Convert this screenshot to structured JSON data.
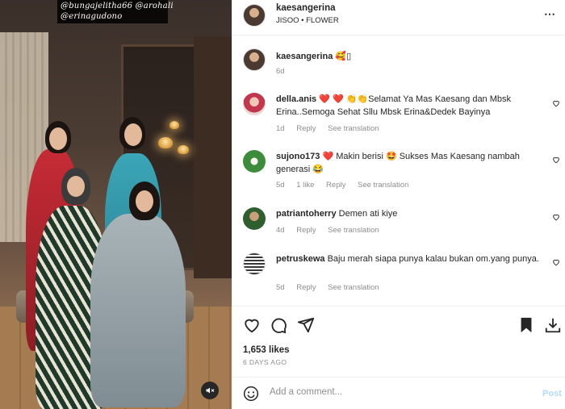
{
  "photo": {
    "tags": [
      "@bungajelitha66 @arohali",
      "@erinagudono"
    ],
    "mute_icon": "speaker-muted-icon"
  },
  "header": {
    "username": "kaesangerina",
    "audio": "JISOO • FLOWER",
    "more_icon": "ellipsis-icon"
  },
  "caption": {
    "username": "kaesangerina",
    "text": "🥰▯",
    "age": "6d"
  },
  "comments": [
    {
      "username": "della.anis",
      "text": "❤️ ❤️ 👏👏Selamat Ya Mas Kaesang dan Mbsk Erina..Semoga Sehat Sllu Mbsk Erina&Dedek Bayinya",
      "age": "1d",
      "likes": "",
      "reply": "Reply",
      "translate": "See translation"
    },
    {
      "username": "sujono173",
      "text": "❤️ Makin berisi 🤩 Sukses Mas Kaesang nambah generasi 😂",
      "age": "5d",
      "likes": "1 like",
      "reply": "Reply",
      "translate": "See translation"
    },
    {
      "username": "patriantoherry",
      "text": "Demen ati kiye",
      "age": "4d",
      "likes": "",
      "reply": "Reply",
      "translate": "See translation"
    },
    {
      "username": "petruskewa",
      "text": "Baju merah siapa punya kalau bukan om.yang punya.",
      "age": "5d",
      "likes": "",
      "reply": "Reply",
      "translate": "See translation"
    }
  ],
  "actions": {
    "like_icon": "heart-icon",
    "comment_icon": "comment-bubble-icon",
    "share_icon": "paper-plane-icon",
    "save_icon": "bookmark-icon",
    "download_icon": "download-icon"
  },
  "likes": "1,653 likes",
  "date": "6 DAYS AGO",
  "add_comment": {
    "emoji_icon": "smiley-icon",
    "placeholder": "Add a comment...",
    "post_label": "Post"
  },
  "colors": {
    "text": "#262626",
    "muted": "#8e8e8e",
    "heart_red": "#ed4956",
    "post_blue_disabled": "#b3dbff"
  }
}
